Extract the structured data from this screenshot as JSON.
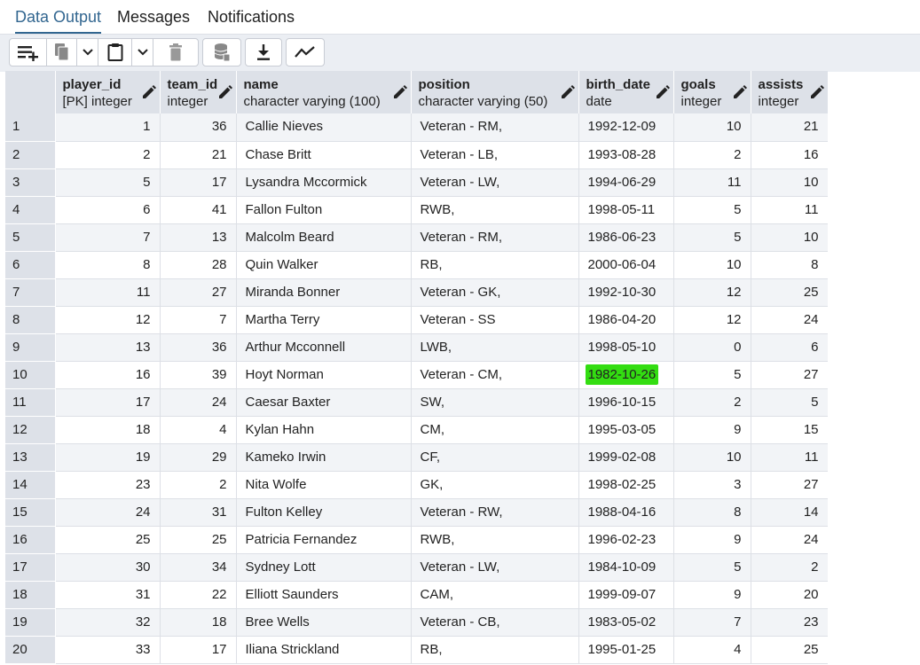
{
  "tabs": [
    {
      "label": "Data Output",
      "active": true
    },
    {
      "label": "Messages",
      "active": false
    },
    {
      "label": "Notifications",
      "active": false
    }
  ],
  "toolbar": {
    "buttons": [
      "add-row-icon",
      "copy-icon",
      "chevron-down-icon",
      "paste-icon",
      "chevron-down-icon",
      "delete-icon",
      "save-data-icon",
      "download-icon",
      "graph-icon"
    ]
  },
  "grid": {
    "columns": [
      {
        "name": "",
        "type": ""
      },
      {
        "name": "player_id",
        "type": "[PK] integer"
      },
      {
        "name": "team_id",
        "type": "integer"
      },
      {
        "name": "name",
        "type": "character varying (100)"
      },
      {
        "name": "position",
        "type": "character varying (50)"
      },
      {
        "name": "birth_date",
        "type": "date"
      },
      {
        "name": "goals",
        "type": "integer"
      },
      {
        "name": "assists",
        "type": "integer"
      }
    ],
    "rows": [
      [
        "1",
        "1",
        "36",
        "Callie Nieves",
        "Veteran - RM,",
        "1992-12-09",
        "10",
        "21"
      ],
      [
        "2",
        "2",
        "21",
        "Chase Britt",
        "Veteran - LB,",
        "1993-08-28",
        "2",
        "16"
      ],
      [
        "3",
        "5",
        "17",
        "Lysandra Mccormick",
        "Veteran - LW,",
        "1994-06-29",
        "11",
        "10"
      ],
      [
        "4",
        "6",
        "41",
        "Fallon Fulton",
        "RWB,",
        "1998-05-11",
        "5",
        "11"
      ],
      [
        "5",
        "7",
        "13",
        "Malcolm Beard",
        "Veteran - RM,",
        "1986-06-23",
        "5",
        "10"
      ],
      [
        "6",
        "8",
        "28",
        "Quin Walker",
        "RB,",
        "2000-06-04",
        "10",
        "8"
      ],
      [
        "7",
        "11",
        "27",
        "Miranda Bonner",
        "Veteran - GK,",
        "1992-10-30",
        "12",
        "25"
      ],
      [
        "8",
        "12",
        "7",
        "Martha Terry",
        "Veteran - SS",
        "1986-04-20",
        "12",
        "24"
      ],
      [
        "9",
        "13",
        "36",
        "Arthur Mcconnell",
        "LWB,",
        "1998-05-10",
        "0",
        "6"
      ],
      [
        "10",
        "16",
        "39",
        "Hoyt Norman",
        "Veteran - CM,",
        "1982-10-26",
        "5",
        "27"
      ],
      [
        "11",
        "17",
        "24",
        "Caesar Baxter",
        "SW,",
        "1996-10-15",
        "2",
        "5"
      ],
      [
        "12",
        "18",
        "4",
        "Kylan Hahn",
        "CM,",
        "1995-03-05",
        "9",
        "15"
      ],
      [
        "13",
        "19",
        "29",
        "Kameko Irwin",
        "CF,",
        "1999-02-08",
        "10",
        "11"
      ],
      [
        "14",
        "23",
        "2",
        "Nita Wolfe",
        "GK,",
        "1998-02-25",
        "3",
        "27"
      ],
      [
        "15",
        "24",
        "31",
        "Fulton Kelley",
        "Veteran - RW,",
        "1988-04-16",
        "8",
        "14"
      ],
      [
        "16",
        "25",
        "25",
        "Patricia Fernandez",
        "RWB,",
        "1996-02-23",
        "9",
        "24"
      ],
      [
        "17",
        "30",
        "34",
        "Sydney Lott",
        "Veteran - LW,",
        "1984-10-09",
        "5",
        "2"
      ],
      [
        "18",
        "31",
        "22",
        "Elliott Saunders",
        "CAM,",
        "1999-09-07",
        "9",
        "20"
      ],
      [
        "19",
        "32",
        "18",
        "Bree Wells",
        "Veteran - CB,",
        "1983-05-02",
        "7",
        "23"
      ],
      [
        "20",
        "33",
        "17",
        "Iliana Strickland",
        "RB,",
        "1995-01-25",
        "4",
        "25"
      ]
    ],
    "highlight": {
      "row": 10,
      "column": "birth_date",
      "color": "#33dd11"
    }
  },
  "colors": {
    "accent": "#326690",
    "header_bg": "#dde1e8",
    "toolbar_bg": "#ebeef3",
    "stripe": "#f2f4f7"
  }
}
